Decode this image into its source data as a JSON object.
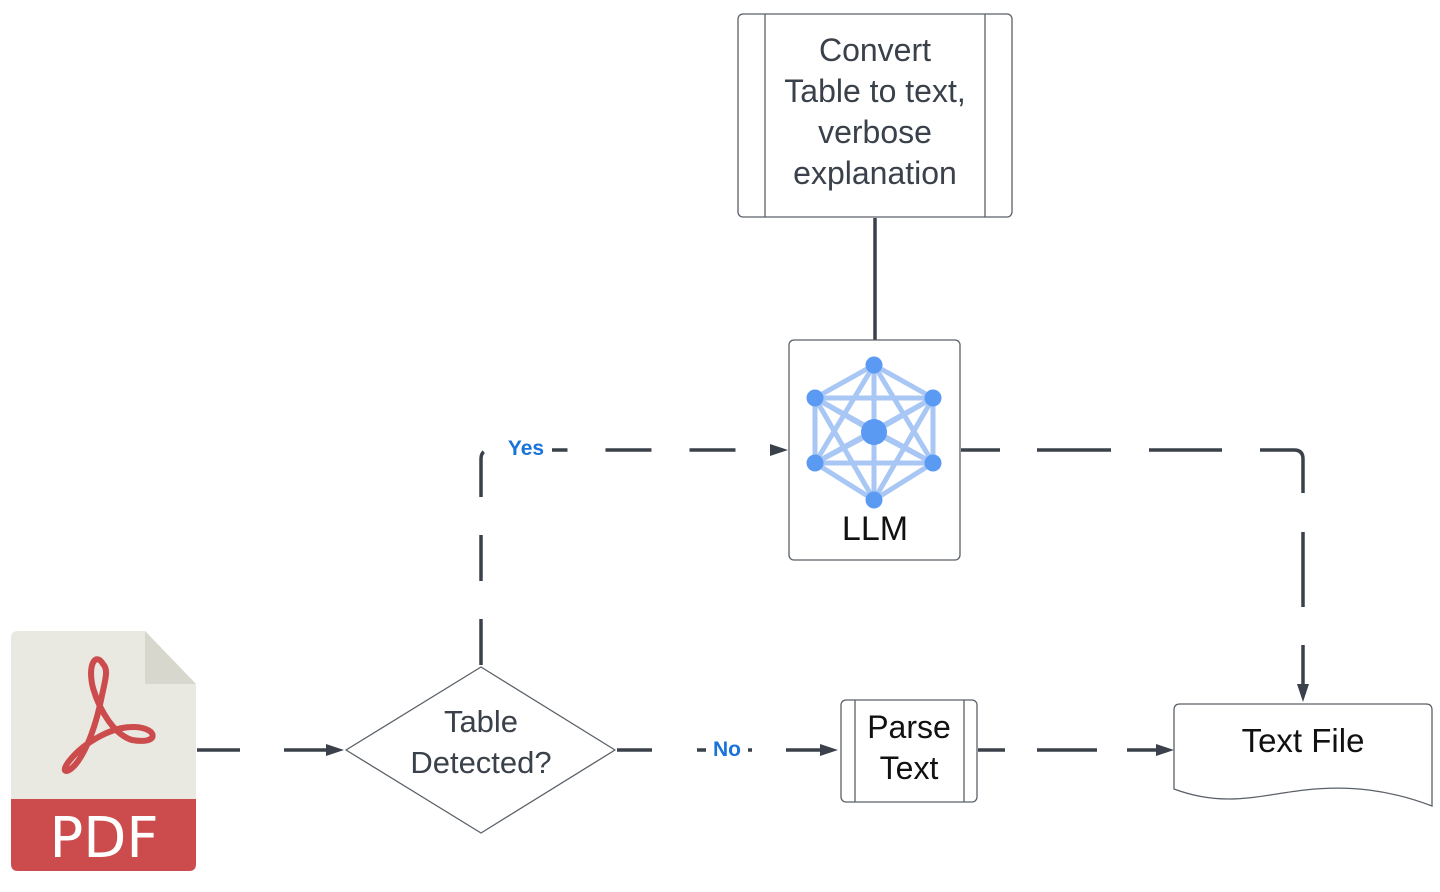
{
  "diagram": {
    "nodes": {
      "pdf": {
        "label": "PDF",
        "icon": "pdf-file-icon",
        "colors": {
          "page": "#e9e8e1",
          "fold": "#d8d7ce",
          "band": "#cc4b4c",
          "glyph": "#cc4b4c",
          "text": "#ffffff"
        }
      },
      "decision": {
        "line1": "Table",
        "line2": "Detected?"
      },
      "convert": {
        "line1": "Convert",
        "line2": "Table to text,",
        "line3": "verbose",
        "line4": "explanation"
      },
      "llm": {
        "label": "LLM",
        "icon": "neural-network-icon",
        "colors": {
          "edge": "#a8c7f5",
          "node": "#5b9af2"
        }
      },
      "parse": {
        "line1": "Parse",
        "line2": "Text"
      },
      "textfile": {
        "label": "Text File"
      }
    },
    "edges": {
      "yes_label": "Yes",
      "no_label": "No"
    },
    "colors": {
      "connector": "#3a414a",
      "edge_label": "#1a73d9",
      "shape_border": "#5a6068"
    }
  }
}
